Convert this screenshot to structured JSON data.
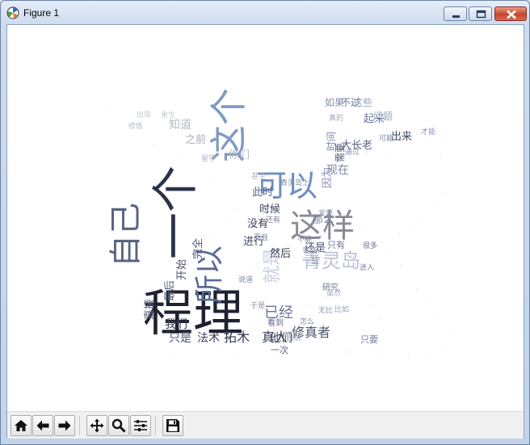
{
  "window": {
    "title": "Figure 1"
  },
  "toolbar": {
    "buttons": [
      {
        "name": "home-button",
        "icon": "home-icon"
      },
      {
        "name": "back-button",
        "icon": "arrow-left-icon"
      },
      {
        "name": "forward-button",
        "icon": "arrow-right-icon"
      },
      {
        "name": "pan-button",
        "icon": "move-icon"
      },
      {
        "name": "zoom-button",
        "icon": "magnifier-icon"
      },
      {
        "name": "configure-subplots-button",
        "icon": "sliders-icon"
      },
      {
        "name": "save-button",
        "icon": "floppy-disk-icon"
      }
    ]
  },
  "wordcloud": {
    "words": [
      {
        "text": "程理",
        "color": "#1e2230"
      },
      {
        "text": "一个",
        "color": "#2c3348"
      },
      {
        "text": "这个",
        "color": "#7f9ac2"
      },
      {
        "text": "可以",
        "color": "#6e8fc0"
      },
      {
        "text": "这样",
        "color": "#8a8a96"
      },
      {
        "text": "自己",
        "color": "#5a6480"
      },
      {
        "text": "所以",
        "color": "#5a6b98"
      },
      {
        "text": "青灵岛",
        "color": "#b9c2d6"
      },
      {
        "text": "就是",
        "color": "#c7cfe0"
      },
      {
        "text": "已经",
        "color": "#6c7692"
      },
      {
        "text": "修真者",
        "color": "#4a5570"
      },
      {
        "text": "真人",
        "color": "#3c4258"
      },
      {
        "text": "拓木",
        "color": "#2f3447"
      },
      {
        "text": "法术",
        "color": "#3b4157"
      },
      {
        "text": "只是",
        "color": "#4d5470"
      },
      {
        "text": "他们",
        "color": "#3f4660"
      },
      {
        "text": "我们",
        "color": "#3a4055"
      },
      {
        "text": "直接",
        "color": "#5c647c"
      },
      {
        "text": "最后",
        "color": "#555d77"
      },
      {
        "text": "开始",
        "color": "#4a5168"
      },
      {
        "text": "完全",
        "color": "#4f587a"
      },
      {
        "text": "然后",
        "color": "#363c52"
      },
      {
        "text": "还是",
        "color": "#4b5370"
      },
      {
        "text": "进行",
        "color": "#3e455e"
      },
      {
        "text": "没有",
        "color": "#39405a"
      },
      {
        "text": "时候",
        "color": "#474e69"
      },
      {
        "text": "现在",
        "color": "#7788a8"
      },
      {
        "text": "因为",
        "color": "#8c96ae"
      },
      {
        "text": "此时",
        "color": "#5d6788"
      },
      {
        "text": "那么",
        "color": "#7d86a0"
      },
      {
        "text": "大长老",
        "color": "#5b6584"
      },
      {
        "text": "起来",
        "color": "#6f7d9f"
      },
      {
        "text": "如果",
        "color": "#8290b0"
      },
      {
        "text": "不过",
        "color": "#67739a"
      },
      {
        "text": "这些",
        "color": "#94a3c2"
      },
      {
        "text": "问题",
        "color": "#9aa8c4"
      },
      {
        "text": "需要",
        "color": "#4c5573"
      },
      {
        "text": "出来",
        "color": "#3f4763"
      },
      {
        "text": "时间",
        "color": "#7a8cb4"
      },
      {
        "text": "知道",
        "color": "#b3b8c6"
      },
      {
        "text": "之前",
        "color": "#a9aebe"
      },
      {
        "text": "你们",
        "color": "#b5bac8"
      },
      {
        "text": "只有",
        "color": "#6d7596"
      },
      {
        "text": "一些",
        "color": "#8a93ad"
      },
      {
        "text": "看到",
        "color": "#61698a"
      },
      {
        "text": "一次",
        "color": "#5e6785"
      },
      {
        "text": "只要",
        "color": "#7a82a0"
      },
      {
        "text": "研究",
        "color": "#6f7898"
      },
      {
        "text": "通过",
        "color": "#8b95b2"
      },
      {
        "text": "可能",
        "color": "#7c87a8"
      },
      {
        "text": "才能",
        "color": "#8e98b4"
      },
      {
        "text": "青灵",
        "color": "#7d879f"
      },
      {
        "text": "岛上",
        "color": "#8c94a8"
      },
      {
        "text": "比如",
        "color": "#9aa2b6"
      },
      {
        "text": "虽然",
        "color": "#a1a9bc"
      },
      {
        "text": "不能",
        "color": "#7e86a2"
      },
      {
        "text": "事情",
        "color": "#9198ae"
      },
      {
        "text": "而且",
        "color": "#6f7794"
      },
      {
        "text": "还有",
        "color": "#7a829c"
      },
      {
        "text": "发现",
        "color": "#8890a8"
      },
      {
        "text": "很多",
        "color": "#6a7290"
      },
      {
        "text": "进入",
        "color": "#7c84a0"
      },
      {
        "text": "怎么",
        "color": "#858da6"
      },
      {
        "text": "无比",
        "color": "#9097ad"
      },
      {
        "text": "自然",
        "color": "#7a809a"
      },
      {
        "text": "于是",
        "color": "#8890a6"
      },
      {
        "text": "说道",
        "color": "#7e86a0"
      },
      {
        "text": "灵力",
        "color": "#8b92a8"
      },
      {
        "text": "真的",
        "color": "#a0a7bb"
      },
      {
        "text": "修炼",
        "color": "#b6bccc"
      },
      {
        "text": "出现",
        "color": "#c1c6d2"
      },
      {
        "text": "甚至",
        "color": "#b0b6c6"
      },
      {
        "text": "星宇",
        "color": "#aab0c2"
      },
      {
        "text": "重生",
        "color": "#c3c8d4"
      }
    ]
  }
}
